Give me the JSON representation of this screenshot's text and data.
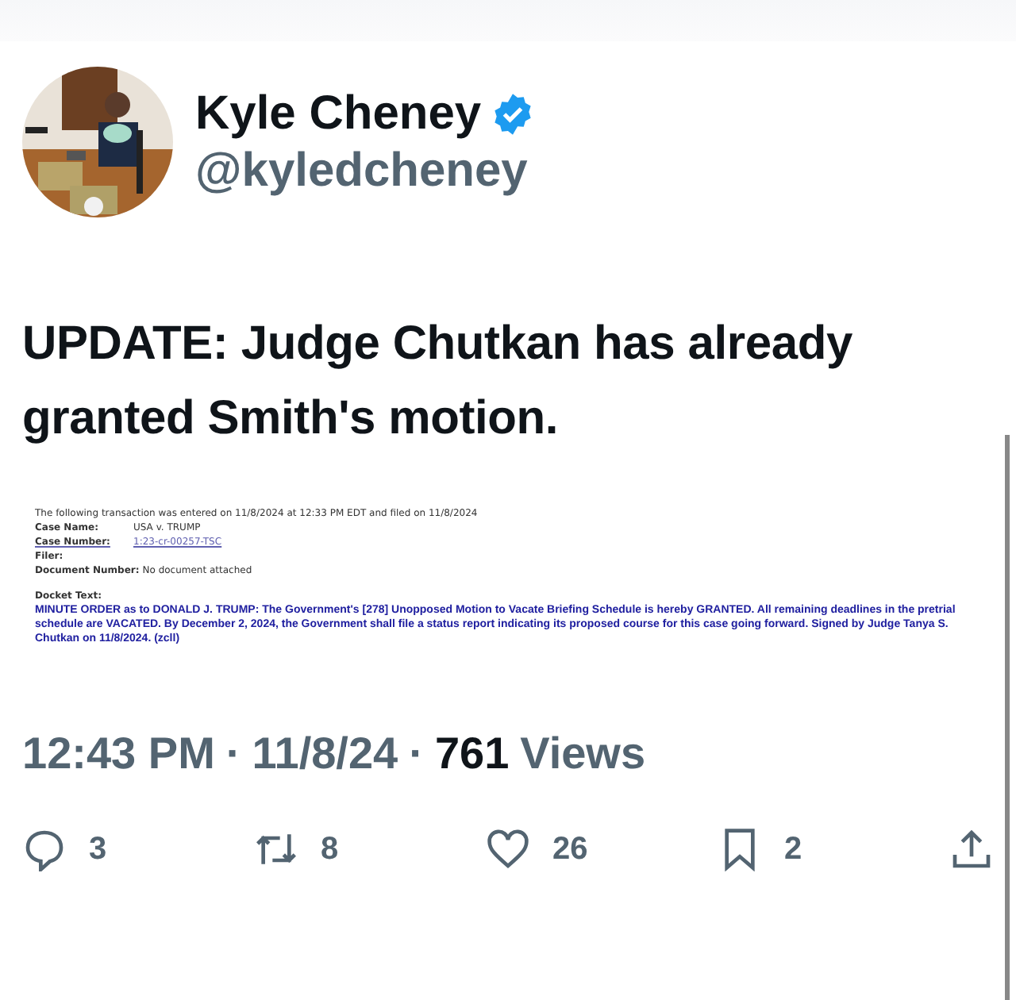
{
  "author": {
    "name": "Kyle Cheney",
    "verified": true,
    "handle": "@kyledcheney"
  },
  "text": "UPDATE: Judge Chutkan has already granted Smith's motion.",
  "document": {
    "intro": "The following transaction was entered on 11/8/2024 at 12:33 PM EDT and filed on 11/8/2024",
    "fields": [
      {
        "label": "Case Name:",
        "value": "USA v. TRUMP",
        "kind": "plain"
      },
      {
        "label": "Case Number:",
        "value": "1:23-cr-00257-TSC",
        "kind": "link"
      },
      {
        "label": "Filer:",
        "kind": "plain"
      },
      {
        "label": "Document Number:",
        "value": "No document attached",
        "kind": "plain"
      }
    ],
    "docket_label": "Docket Text:",
    "docket_text": "MINUTE ORDER as to DONALD J. TRUMP: The Government's [278] Unopposed Motion to Vacate Briefing Schedule is hereby GRANTED. All remaining deadlines in the pretrial schedule are VACATED. By December 2, 2024, the Government shall file a status report indicating its proposed course for this case going forward. Signed by Judge Tanya S. Chutkan on 11/8/2024. (zcll)"
  },
  "meta": {
    "time": "12:43 PM",
    "separator_1": "·",
    "date": "11/8/24",
    "separator_2": "·",
    "views": "761",
    "views_label": "Views"
  },
  "actions": [
    {
      "kind": "reply",
      "count": "3"
    },
    {
      "kind": "repost",
      "count": "8"
    },
    {
      "kind": "like",
      "count": "26"
    },
    {
      "kind": "bookmark",
      "count": "2"
    },
    {
      "kind": "share"
    }
  ]
}
